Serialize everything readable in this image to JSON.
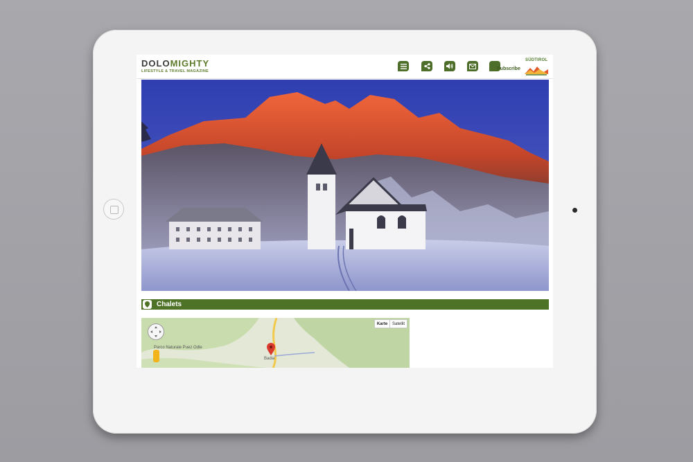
{
  "header": {
    "logo_part1": "DOLO",
    "logo_part2": "MIGHTY",
    "tagline": "LIFESTYLE & TRAVEL MAGAZINE",
    "icons": [
      "menu-icon",
      "share-icon",
      "audio-icon",
      "mail-icon"
    ],
    "subscribe_label": "Subscribe",
    "partner_logo_text": "SÜDTIROL"
  },
  "hero": {
    "icon": "mountain-church-photo"
  },
  "section": {
    "title": "Chalets",
    "icon": "location-pin-icon"
  },
  "map": {
    "toggle_map": "Karte",
    "toggle_satellite": "Satellit",
    "park_label": "Parco Naturale Puez Odle",
    "town_label": "Badia"
  },
  "colors": {
    "brand_green": "#4f7326",
    "brand_dark": "#3a3a3a"
  }
}
